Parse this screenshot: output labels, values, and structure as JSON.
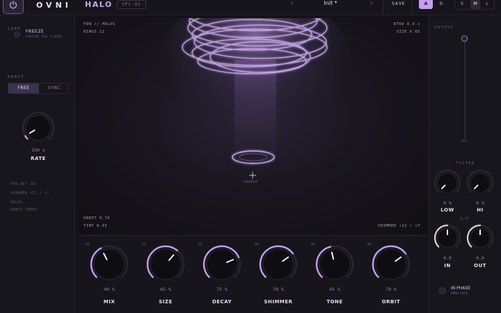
{
  "header": {
    "brand": "OVNI",
    "product": "HALO",
    "model": "SPC-02",
    "prev_arrow": "‹",
    "next_arrow": "›",
    "preset_name": "Init *",
    "save_label": "SAVE",
    "ab": [
      "A",
      "B"
    ],
    "ab_active": "A",
    "size_modes": [
      "S",
      "M",
      "L"
    ],
    "size_active": "M"
  },
  "left_panel": {
    "core_heading": "CORE",
    "freeze_label": "FREEZE",
    "freeze_sub": "FREEZE THE CLOUD",
    "orbit_heading": "ORBIT",
    "orbit_modes": [
      "FREE",
      "SYNC"
    ],
    "orbit_active": "FREE",
    "rate": {
      "label": "RATE",
      "value_text": "100 s",
      "level": 0.05
    },
    "info_list": [
      "FDN NET 16x",
      "SHIMMER +12 / +7",
      "HALOS",
      "ORBIT TEMPO"
    ]
  },
  "display": {
    "top_left_1": "FDN // HALOS",
    "top_left_2": "RINGS 12",
    "top_right_1": "RT60 8.0 s",
    "top_right_2": "SIZE 0.65",
    "source_label": "SOURCE",
    "bottom_left_1": "ORBIT 0.70",
    "bottom_left_2": "TINT 0.45",
    "bottom_right": "SHIMMER +12 / +7"
  },
  "knobs": [
    {
      "index": "01",
      "label": "MIX",
      "value_text": "40 %",
      "level": 0.4
    },
    {
      "index": "02",
      "label": "SIZE",
      "value_text": "65 %",
      "level": 0.65
    },
    {
      "index": "03",
      "label": "DECAY",
      "value_text": "75 %",
      "level": 0.75
    },
    {
      "index": "04",
      "label": "SHIMMER",
      "value_text": "70 %",
      "level": 0.7
    },
    {
      "index": "05",
      "label": "TONE",
      "value_text": "45 %",
      "level": 0.45
    },
    {
      "index": "06",
      "label": "ORBIT",
      "value_text": "70 %",
      "level": 0.7
    }
  ],
  "right_panel": {
    "output_heading": "OUTPUT",
    "fader_label": "OUT",
    "fader_level": 1.0,
    "filter_heading": "FILTER",
    "low": {
      "label": "LOW",
      "value_text": "0 %",
      "level": 0.0
    },
    "hi": {
      "label": "HI",
      "value_text": "0 %",
      "level": 0.0
    },
    "io_heading": "I/O",
    "in": {
      "label": "IN",
      "value_text": "0.0",
      "level": 0.0
    },
    "out": {
      "label": "OUT",
      "value_text": "0.0",
      "level": 0.0
    },
    "phase_label": "IN PHASE",
    "phase_sub": "MONO SAFE"
  },
  "colors": {
    "accent": "#c49ef0",
    "accent_glow": "#a97ee6",
    "track": "#2c2833",
    "knob_body": "#0e0d11",
    "white_arc": "#d8d4e2"
  }
}
